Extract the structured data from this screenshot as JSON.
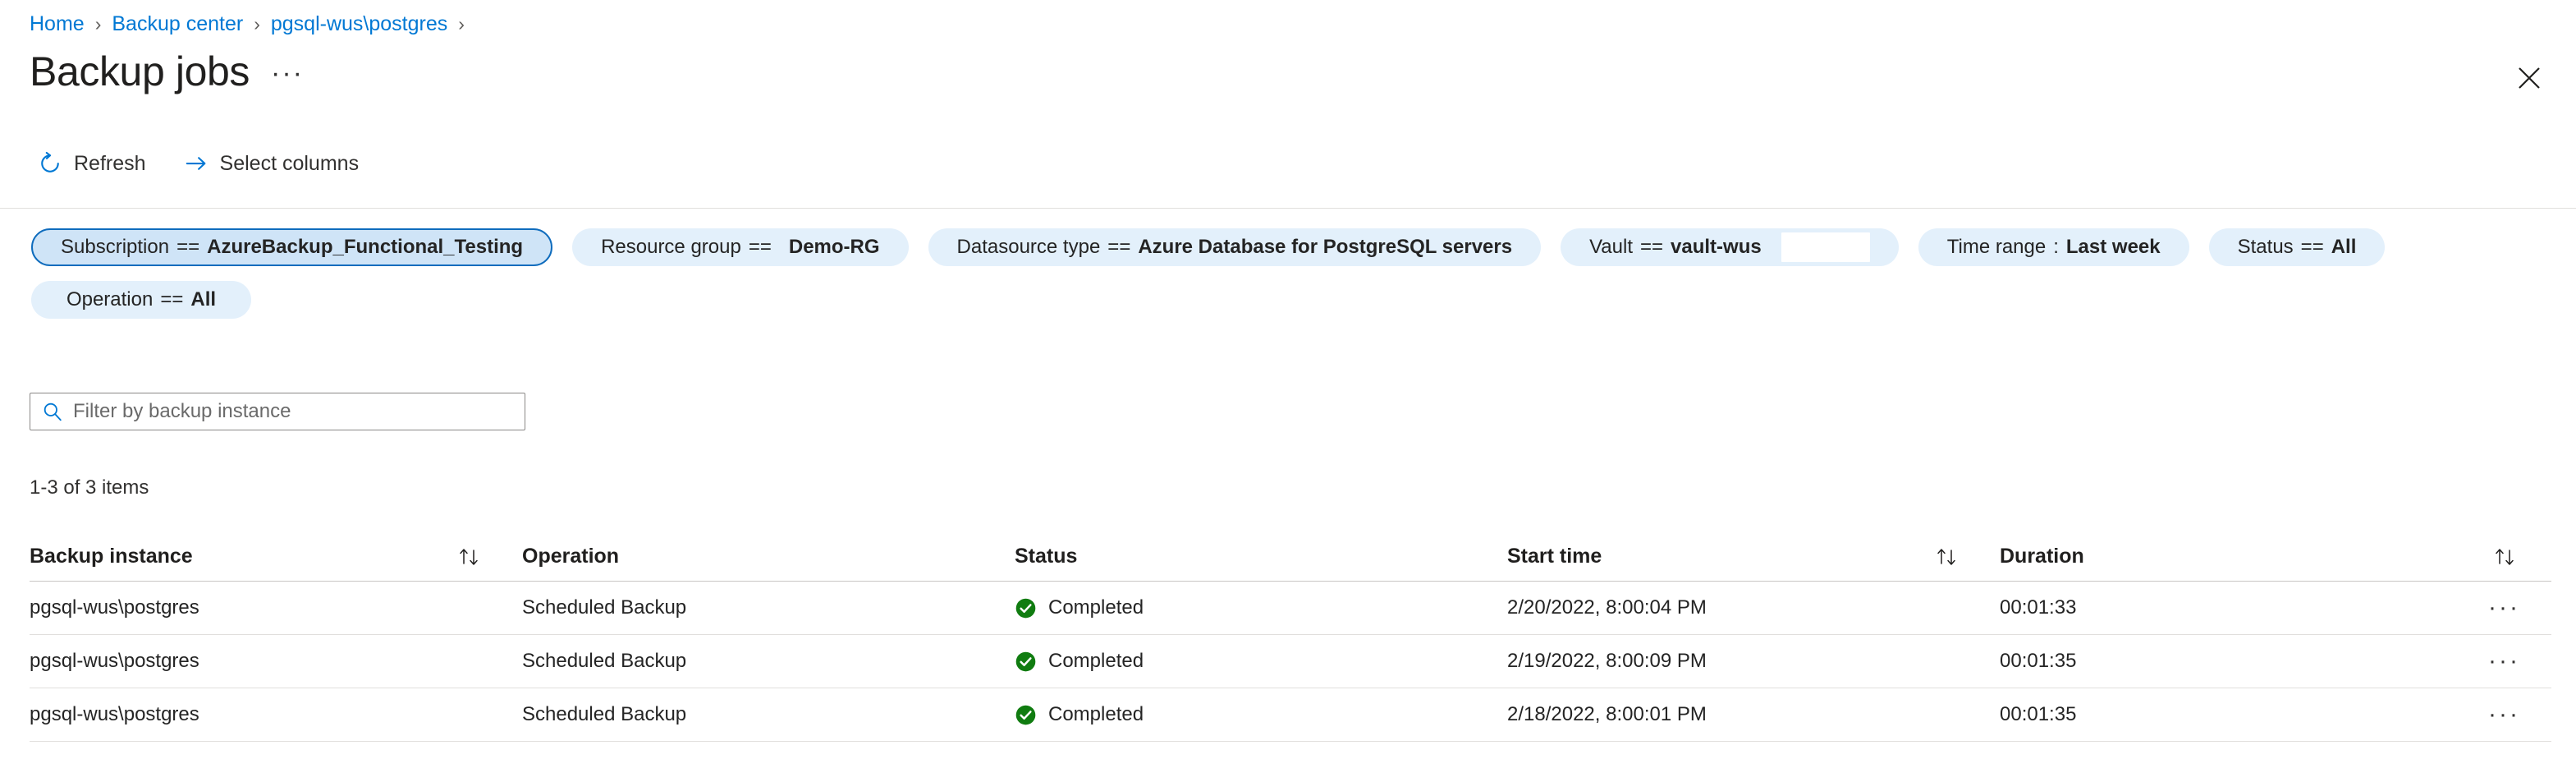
{
  "breadcrumb": {
    "items": [
      {
        "label": "Home"
      },
      {
        "label": "Backup center"
      },
      {
        "label": "pgsql-wus\\postgres"
      }
    ],
    "separator": "›"
  },
  "header": {
    "title": "Backup jobs",
    "ellipsis": "···",
    "close_icon": "close-icon"
  },
  "toolbar": {
    "commands": [
      {
        "label": "Refresh",
        "icon": "refresh-icon"
      },
      {
        "label": "Select columns",
        "icon": "arrow-right-icon"
      }
    ]
  },
  "filters": [
    {
      "key": "Subscription",
      "op": "==",
      "value": "AzureBackup_Functional_Testing",
      "selected": true
    },
    {
      "key": "Resource group",
      "op": "==",
      "value": "Demo-RG",
      "selected": false,
      "wide_gap": true
    },
    {
      "key": "Datasource type",
      "op": "==",
      "value": "Azure Database for PostgreSQL servers",
      "selected": false
    },
    {
      "key": "Vault",
      "op": "==",
      "value": "vault-wus",
      "selected": false,
      "white_slot": true
    },
    {
      "key": "Time range",
      "op": ":",
      "value": "Last week",
      "selected": false
    },
    {
      "key": "Status",
      "op": "==",
      "value": "All",
      "selected": false
    },
    {
      "key": "Operation",
      "op": "==",
      "value": "All",
      "selected": false
    }
  ],
  "search": {
    "placeholder": "Filter by backup instance",
    "value": "",
    "icon": "search-icon"
  },
  "results": {
    "count_label": "1-3 of 3 items"
  },
  "table": {
    "columns": [
      {
        "label": "Backup instance",
        "sortable": true
      },
      {
        "label": "Operation",
        "sortable": false
      },
      {
        "label": "Status",
        "sortable": false
      },
      {
        "label": "Start time",
        "sortable": true
      },
      {
        "label": "Duration",
        "sortable": false
      },
      {
        "label": "",
        "sortable": true
      }
    ],
    "rows": [
      {
        "instance": "pgsql-wus\\postgres",
        "operation": "Scheduled Backup",
        "status": "Completed",
        "status_icon": "success-check-icon",
        "start_time": "2/20/2022, 8:00:04 PM",
        "duration": "00:01:33",
        "menu": "···"
      },
      {
        "instance": "pgsql-wus\\postgres",
        "operation": "Scheduled Backup",
        "status": "Completed",
        "status_icon": "success-check-icon",
        "start_time": "2/19/2022, 8:00:09 PM",
        "duration": "00:01:35",
        "menu": "···"
      },
      {
        "instance": "pgsql-wus\\postgres",
        "operation": "Scheduled Backup",
        "status": "Completed",
        "status_icon": "success-check-icon",
        "start_time": "2/18/2022, 8:00:01 PM",
        "duration": "00:01:35",
        "menu": "···"
      }
    ]
  },
  "colors": {
    "link": "#0078d4",
    "pill_bg": "#e3f0fb",
    "pill_selected_bg": "#cfe4f7",
    "pill_selected_border": "#0f6cbd",
    "success_green": "#107c10",
    "text": "#242424"
  }
}
